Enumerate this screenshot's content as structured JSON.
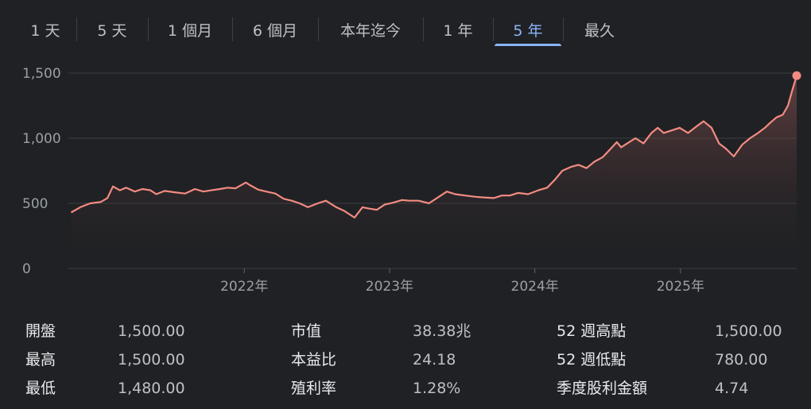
{
  "range_tabs": [
    {
      "label": "1 天",
      "active": false
    },
    {
      "label": "5 天",
      "active": false
    },
    {
      "label": "1 個月",
      "active": false
    },
    {
      "label": "6 個月",
      "active": false
    },
    {
      "label": "本年迄今",
      "active": false
    },
    {
      "label": "1 年",
      "active": false
    },
    {
      "label": "5 年",
      "active": true
    },
    {
      "label": "最久",
      "active": false
    }
  ],
  "colors": {
    "line": "#f28b82",
    "fill_top": "#7a4a4a",
    "grid": "#3c4043",
    "active_tab": "#8ab4f8"
  },
  "chart_data": {
    "type": "area",
    "title": "",
    "xlabel": "",
    "ylabel": "",
    "ylim": [
      0,
      1500
    ],
    "yticks": [
      {
        "value": 0,
        "label": "0"
      },
      {
        "value": 500,
        "label": "500"
      },
      {
        "value": 1000,
        "label": "1,000"
      },
      {
        "value": 1500,
        "label": "1,500"
      }
    ],
    "xlim": [
      "2020-10-20",
      "2025-10-20"
    ],
    "xticks": [
      {
        "value": "2022-01-01",
        "label": "2022年"
      },
      {
        "value": "2023-01-01",
        "label": "2023年"
      },
      {
        "value": "2024-01-01",
        "label": "2024年"
      },
      {
        "value": "2025-01-01",
        "label": "2025年"
      }
    ],
    "grid": true,
    "series": [
      {
        "x": [
          "2020-10-23",
          "2020-11-15",
          "2020-12-10",
          "2021-01-05",
          "2021-01-22",
          "2021-02-05",
          "2021-02-22",
          "2021-03-10",
          "2021-04-01",
          "2021-04-20",
          "2021-05-10",
          "2021-05-25",
          "2021-06-15",
          "2021-07-10",
          "2021-08-05",
          "2021-08-30",
          "2021-09-20",
          "2021-10-10",
          "2021-11-01",
          "2021-11-20",
          "2021-12-10",
          "2022-01-05",
          "2022-01-15",
          "2022-02-05",
          "2022-02-25",
          "2022-03-20",
          "2022-04-10",
          "2022-04-30",
          "2022-05-20",
          "2022-06-10",
          "2022-07-05",
          "2022-07-25",
          "2022-08-20",
          "2022-09-10",
          "2022-10-05",
          "2022-10-25",
          "2022-11-10",
          "2022-11-30",
          "2022-12-20",
          "2023-01-10",
          "2023-02-01",
          "2023-02-20",
          "2023-03-15",
          "2023-04-10",
          "2023-05-05",
          "2023-05-25",
          "2023-06-15",
          "2023-07-10",
          "2023-08-05",
          "2023-08-25",
          "2023-09-20",
          "2023-10-10",
          "2023-10-30",
          "2023-11-20",
          "2023-12-15",
          "2024-01-10",
          "2024-02-01",
          "2024-02-20",
          "2024-03-10",
          "2024-04-01",
          "2024-04-20",
          "2024-05-10",
          "2024-05-30",
          "2024-06-20",
          "2024-07-10",
          "2024-07-25",
          "2024-08-05",
          "2024-08-20",
          "2024-09-10",
          "2024-09-30",
          "2024-10-20",
          "2024-11-05",
          "2024-11-20",
          "2024-12-10",
          "2024-12-30",
          "2025-01-20",
          "2025-02-10",
          "2025-02-28",
          "2025-03-20",
          "2025-04-08",
          "2025-04-25",
          "2025-05-15",
          "2025-06-05",
          "2025-06-25",
          "2025-07-15",
          "2025-08-01",
          "2025-08-15",
          "2025-08-30",
          "2025-09-15",
          "2025-09-28",
          "2025-10-10",
          "2025-10-20"
        ],
        "values": [
          430,
          470,
          500,
          510,
          540,
          630,
          600,
          620,
          590,
          610,
          600,
          570,
          595,
          585,
          575,
          610,
          590,
          600,
          610,
          620,
          615,
          660,
          640,
          605,
          590,
          575,
          535,
          520,
          500,
          470,
          500,
          520,
          470,
          440,
          390,
          470,
          460,
          450,
          490,
          505,
          525,
          520,
          520,
          500,
          550,
          590,
          570,
          560,
          550,
          545,
          540,
          560,
          560,
          580,
          570,
          600,
          620,
          680,
          750,
          780,
          795,
          770,
          820,
          855,
          920,
          970,
          930,
          960,
          1000,
          960,
          1040,
          1080,
          1040,
          1060,
          1080,
          1040,
          1090,
          1130,
          1080,
          960,
          920,
          860,
          950,
          1000,
          1040,
          1080,
          1120,
          1160,
          1180,
          1250,
          1380,
          1480
        ]
      }
    ]
  },
  "stats": [
    [
      {
        "label": "開盤",
        "value": "1,500.00"
      },
      {
        "label": "市值",
        "value": "38.38兆"
      },
      {
        "label": "52 週高點",
        "value": "1,500.00"
      }
    ],
    [
      {
        "label": "最高",
        "value": "1,500.00"
      },
      {
        "label": "本益比",
        "value": "24.18"
      },
      {
        "label": "52 週低點",
        "value": "780.00"
      }
    ],
    [
      {
        "label": "最低",
        "value": "1,480.00"
      },
      {
        "label": "殖利率",
        "value": "1.28%"
      },
      {
        "label": "季度股利金額",
        "value": "4.74"
      }
    ]
  ]
}
